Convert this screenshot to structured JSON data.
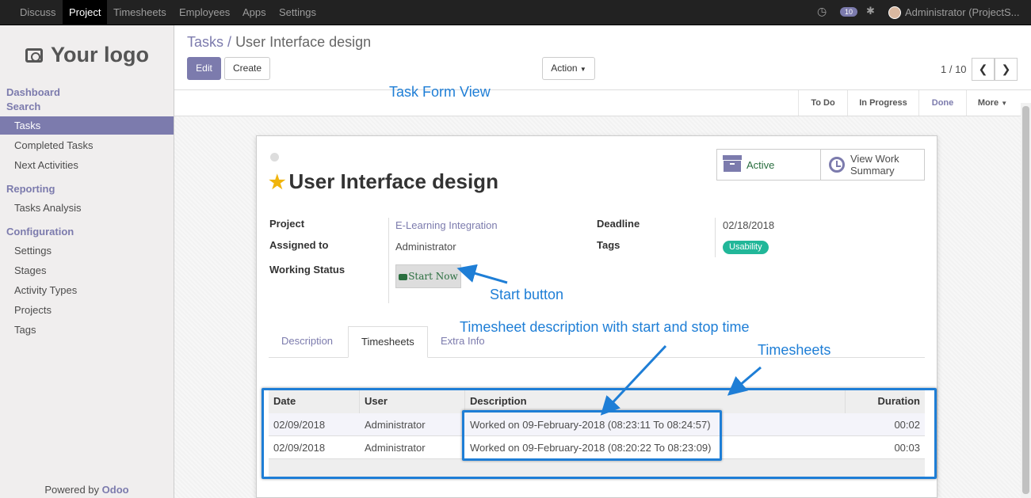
{
  "topbar": {
    "menu": [
      "Discuss",
      "Project",
      "Timesheets",
      "Employees",
      "Apps",
      "Settings"
    ],
    "active": "Project",
    "message_count": "10",
    "user": "Administrator (ProjectS..."
  },
  "sidebar": {
    "logo": "Your logo",
    "sections": [
      {
        "title": "Dashboard"
      },
      {
        "title": "Search",
        "items": [
          "Tasks",
          "Completed Tasks",
          "Next Activities"
        ]
      },
      {
        "title": "Reporting",
        "items": [
          "Tasks Analysis"
        ]
      },
      {
        "title": "Configuration",
        "items": [
          "Settings",
          "Stages",
          "Activity Types",
          "Projects",
          "Tags"
        ]
      }
    ],
    "active_item": "Tasks",
    "powered_by": "Powered by",
    "powered_brand": "Odoo"
  },
  "breadcrumb": {
    "parent": "Tasks",
    "separator": "/",
    "current": "User Interface design"
  },
  "controls": {
    "edit": "Edit",
    "create": "Create",
    "action": "Action",
    "pager": "1 / 10"
  },
  "stages": [
    "To Do",
    "In Progress",
    "Done",
    "More"
  ],
  "current_stage": "Done",
  "form": {
    "title": "User Interface design",
    "smart_buttons": {
      "active": "Active",
      "view_work": "View Work",
      "summary": "Summary"
    },
    "fields": {
      "project_label": "Project",
      "project_value": "E-Learning Integration",
      "assigned_label": "Assigned to",
      "assigned_value": "Administrator",
      "status_label": "Working Status",
      "start_button": "Start Now",
      "deadline_label": "Deadline",
      "deadline_value": "02/18/2018",
      "tags_label": "Tags",
      "tag": "Usability"
    },
    "tabs": [
      "Description",
      "Timesheets",
      "Extra Info"
    ],
    "active_tab": "Timesheets",
    "table": {
      "headers": [
        "Date",
        "User",
        "Description",
        "Duration"
      ],
      "rows": [
        [
          "02/09/2018",
          "Administrator",
          "Worked on 09-February-2018 (08:23:11 To 08:24:57)",
          "00:02"
        ],
        [
          "02/09/2018",
          "Administrator",
          "Worked on 09-February-2018 (08:20:22 To 08:23:09)",
          "00:03"
        ]
      ]
    }
  },
  "annotations": {
    "form_view": "Task Form View",
    "start": "Start button",
    "desc": "Timesheet description with start and stop time",
    "timesheets": "Timesheets"
  },
  "colors": {
    "accent": "#7c7bad",
    "annotation": "#1e7ed6",
    "tag": "#21b799"
  }
}
